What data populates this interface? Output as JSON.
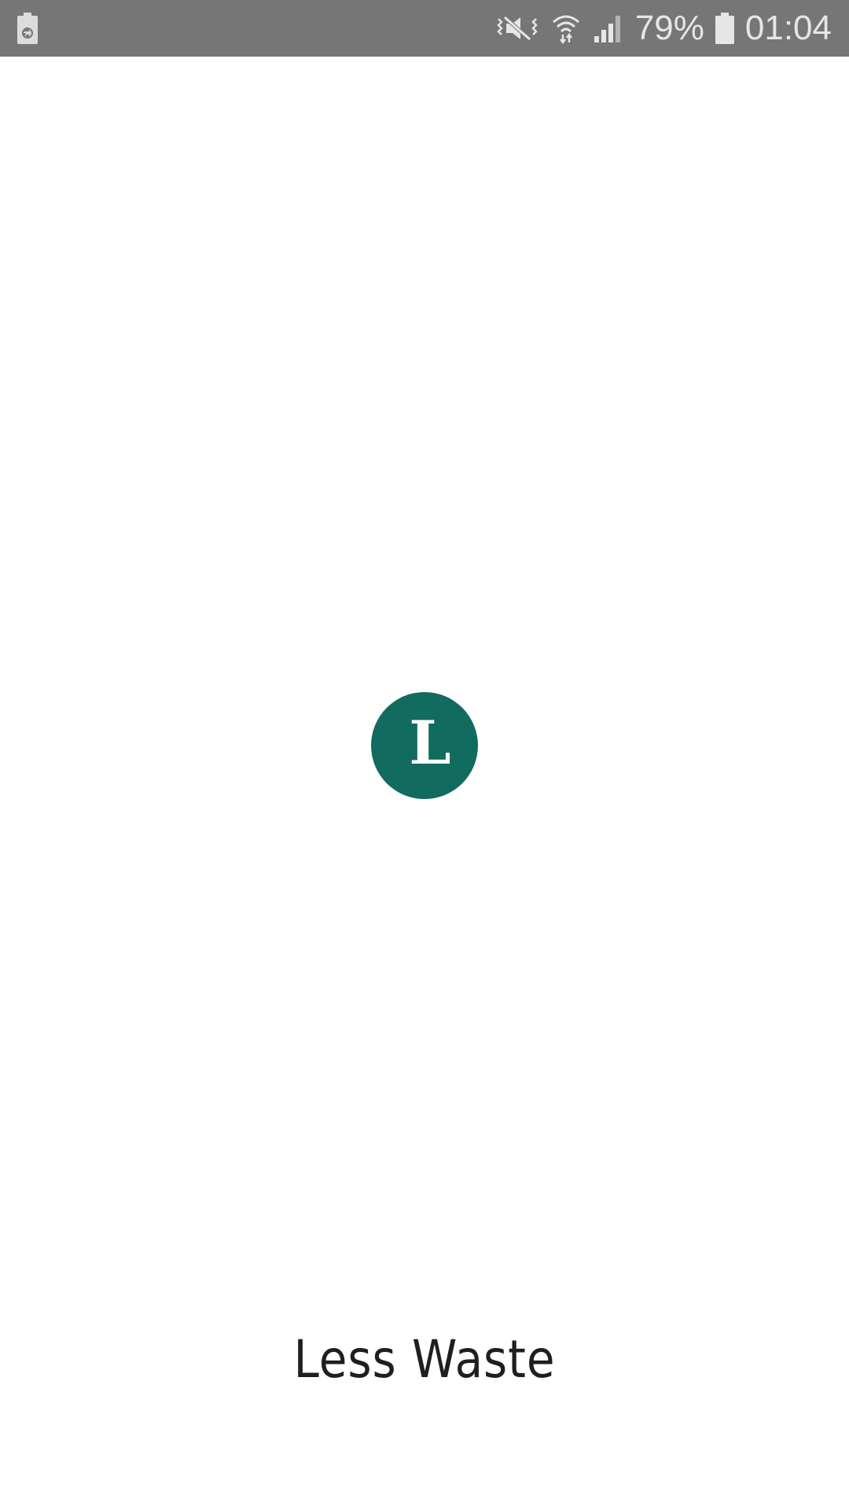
{
  "status_bar": {
    "battery_percent": "79%",
    "time": "01:04",
    "icons": [
      "battery-saver-icon",
      "vibrate-mute-icon",
      "wifi-icon",
      "cell-signal-icon",
      "battery-icon"
    ],
    "background_color": "#767676"
  },
  "splash": {
    "logo_letter": "L",
    "logo_color": "#116b5e",
    "app_name": "Less Waste"
  }
}
